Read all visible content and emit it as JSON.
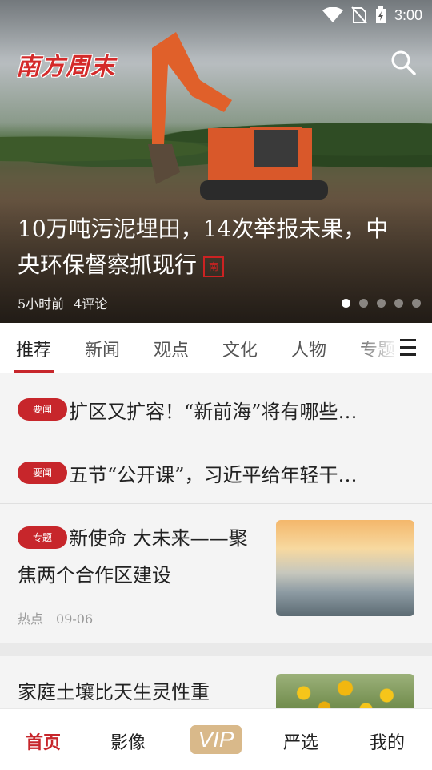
{
  "status_bar": {
    "time": "3:00",
    "icons": [
      "wifi-icon",
      "no-sim-icon",
      "battery-charging-icon"
    ]
  },
  "header": {
    "logo_text": "南方周末",
    "search_icon": "search-icon"
  },
  "hero": {
    "title_line1": "10万吨污泥埋田，14次举报未果，中",
    "title_line2": "央环保督察抓现行",
    "seal_text": "南",
    "time": "5小时前",
    "comments": "4评论",
    "dots": 5,
    "active_dot": 0
  },
  "tabs": [
    "推荐",
    "新闻",
    "观点",
    "文化",
    "人物",
    "专题"
  ],
  "active_tab": 0,
  "news": [
    {
      "badge": "要闻",
      "title": "扩区又扩容！“新前海”将有哪些…"
    },
    {
      "badge": "要闻",
      "title": "五节“公开课”，习近平给年轻干…"
    }
  ],
  "cards": [
    {
      "badge": "专题",
      "title": "新使命 大未来——聚焦两个合作区建设",
      "tag": "热点",
      "date": "09-06"
    },
    {
      "title": "家庭土壤比天生灵性重"
    }
  ],
  "bottom_nav": [
    "首页",
    "影像",
    "VIP",
    "严选",
    "我的"
  ],
  "colors": {
    "accent": "#c7262b",
    "vip": "#d9b98a"
  }
}
